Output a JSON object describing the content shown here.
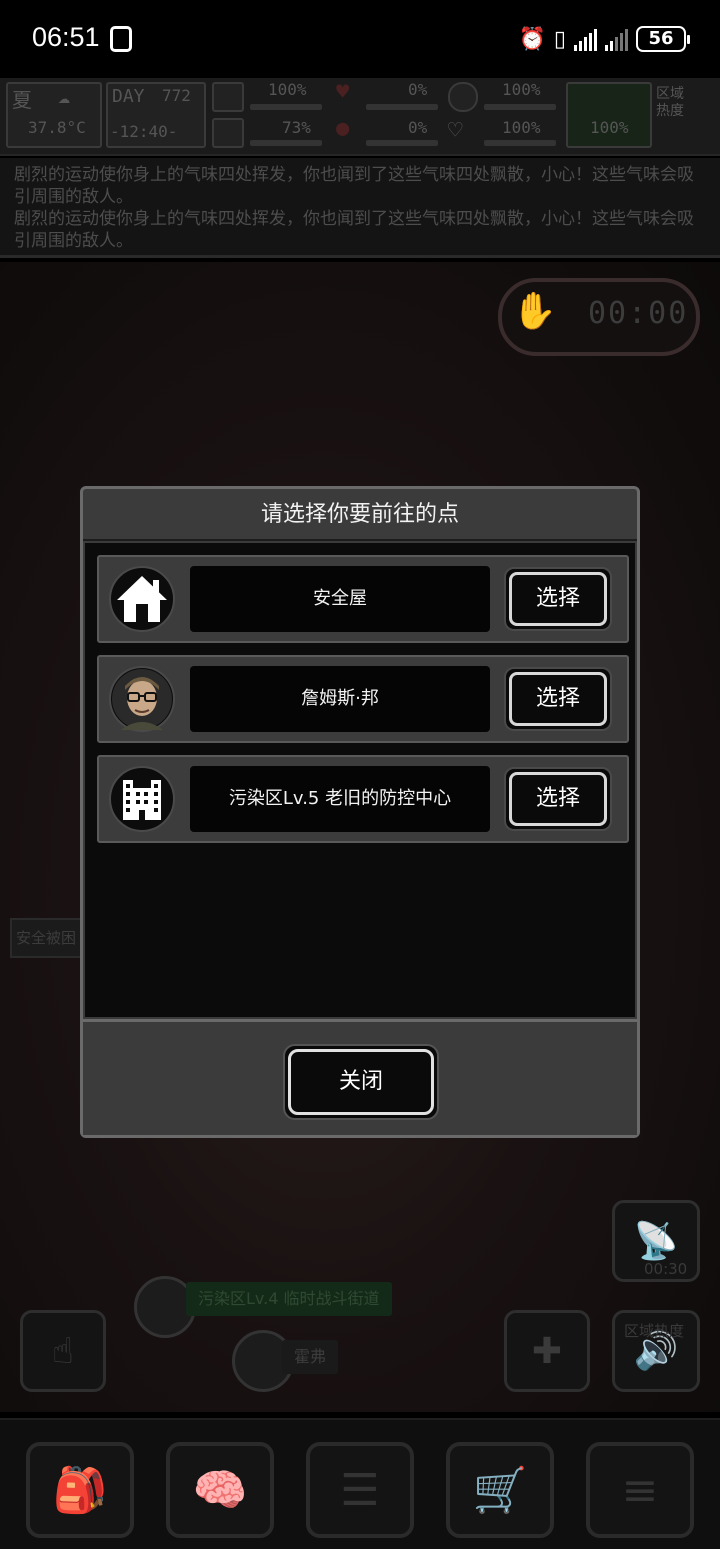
{
  "status_bar": {
    "time": "06:51",
    "battery": "56"
  },
  "hud": {
    "season": "夏",
    "day_label": "DAY",
    "day_value": "772",
    "temperature": "37.8°C",
    "clock": "-12:40-",
    "stat_1": "100%",
    "stat_2": "0%",
    "stat_3": "100%",
    "stat_4": "73%",
    "stat_5": "0%",
    "stat_6": "100%",
    "stat_7": "100%",
    "zone_heat_label": "区域热度"
  },
  "log": {
    "lines": [
      "剧烈的运动使你身上的气味四处挥发，你也闻到了这些气味四处飘散，小心！这些气味会吸引周围的敌人。",
      "剧烈的运动使你身上的气味四处挥发，你也闻到了这些气味四处飘散，小心！这些气味会吸引周围的敌人。"
    ]
  },
  "scene": {
    "timer": "00:00",
    "side_tab": "安全被困",
    "map_label_1": "污染区Lv.4 临时战斗街道",
    "map_label_2": "霍弗",
    "radar_timer": "00:30",
    "zone_heat": "区域热度"
  },
  "dialog": {
    "title": "请选择你要前往的点",
    "select_label": "选择",
    "close_label": "关闭",
    "destinations": [
      {
        "name": "安全屋",
        "icon": "house-icon"
      },
      {
        "name": "詹姆斯·邦",
        "icon": "npc-portrait-icon"
      },
      {
        "name": "污染区Lv.5 老旧的防控中心",
        "icon": "building-icon"
      }
    ]
  }
}
